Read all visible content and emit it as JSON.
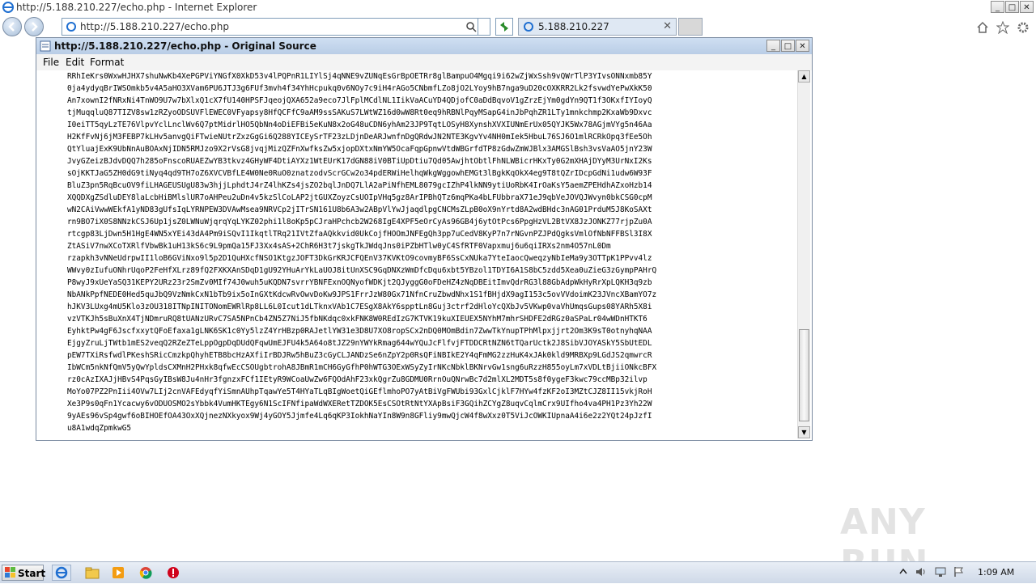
{
  "window": {
    "title": "http://5.188.210.227/echo.php - Internet Explorer",
    "controls": [
      "_",
      "□",
      "✕"
    ]
  },
  "browser": {
    "address_url": "http://5.188.210.227/echo.php",
    "tab_title": "5.188.210.227",
    "tab_close": "✕"
  },
  "source_window": {
    "title": "http://5.188.210.227/echo.php - Original Source",
    "menu": [
      "File",
      "Edit",
      "Format"
    ],
    "lines": [
      "RRhIeKrs0WxwHJHX7shuNwKb4XePGPViYNGfX0XkD53v4lPQPnR1LIYlSj4qNNE9vZUNqEsGrBpOETRr8glBampuO4Mgqi9i62wZjWxSsh9vQWrTlP3YIvsONNxmb85Y",
      "0ja4ydyqBrIWSOmkb5v4A5aHO3XVam6PU6JTJ3g6FUf3mvh4f34YhHcpukq0v6NOy7c9iH4rAGo5CNbmfLZo8jO2LYoy9hB7nga9uD20cOXKRR2Lk2fsvwdYePwXkK50",
      "An7xownI2fNRxNi4TnWO9U7w7bXlxQ1cX7fU140HPSFJqeojQXA652a9eco7JlFplMCdlNL1IikVaACuYD4QDjofC0aDdBqvoV1gZrzEjYm0gdYn9QT1f3OKxfIYIoyQ",
      "tjMuqqluQ87TIZV8sw1zRZyoODSUVFlEWEC0VFyapsy8HfQCFfC9aAM9ssSAKuS7LWtWZ16d0wW8Rt0eq9hRBNlPqyMSapG4inJbPqhZR1LTy1mnkchmp2KxaWb9Dxvc",
      "I0eiTT5qyLzTE76VlpvYclLnclWv6Q7ptMidrlHO5QbNn4oDiEFBi5eKuN8x2oG48uCDN6yhAm23JP9TqtLOSyH8XynshXVXIUNmErUx05QYJK5Wx78AGjmVYg5n46Aa",
      "H2KfFvNj6jM3FEBP7kLHv5anvgQiFTwieNUtrZxzGgGi6Q288YICEySrTF23zLDjnDeARJwnfnDgQRdwJN2NTE3KgvYv4NH0mIek5HbuL76SJ6O1mlRCRkOpq3fEe5Oh",
      "QtYluajExK9UbNnAuBOAxNjIDN5RMJzo9X2rVsG8jvqjMizQZFnXwfksZw5xjopDXtxNmYW5OcaFqpGpnwVtdWBGrfdTP8zGdwZmWJBlx3AMGSlBsh3vsVaAO5jnY23W",
      "JvyGZeizBJdvDQQ7h285oFnscoRUAEZwYB3tkvz4GHyWF4DtiAYXz1WtEUrK17dGN88iV0BTiUpDtiu7Qd05AwjhtObtlFhNLWBicrHKxTy0G2mXHAjDYyM3UrNxI2Ks",
      "sOjKKTJaG5ZH0dG9tiNyq4qd9TH7oZ6XVCVBfLE4W0Ne0RuO0znatzodvScrGCw2o34pdERWiHelhqWkgWggowhEMGt3lBgkKqOkX4eg9T8tQZrIDcpGdNi1udw6W93F",
      "BluZ3pn5RqBcuOV9fiLHAGEUSUgU83w3hjjLphdtJ4rZ4lhKZs4jsZO2bqlJnDQ7LlA2aPiNfhEML8079gcIZhP4lkNN9ytiUoRbK4IrOaKsY5aemZPEHdhAZxoHzb14",
      "XQQDXgZSdluDEY8laLcbHiBMlslUR7oAHPeu2uDn4v5kzSlCoLAP2jtGUXZoyzCsUOIpVHq5gz8ArIPBhQTz6mqPKa4bLFUbbraX71eJ9qbVeJOVQJWvyn0bkCSG0cpM",
      "wN2CAiVwwWEkfA1yND83gUfsIqLYRNPEW3DVAwMsea9NRVCp2jITrSN161U8b6A3w2ABpVlYwJjaqdlpgCNCMsZLpB0oX9nYrtd8A2wdBHdc3nAG01PrduM5J8KoSAXt",
      "rn9BO7iX0S8NNzkCSJ6Up1jsZ0LWNuWjqrqYqLYKZ02phi1l8oKp5pCJraHPchcb2W268IgE4XPF5eOrCyAs96GB4j6ytOtPcs6PpgHzVL2BtVX8JzJONKZ77rjpZu0A",
      "rtcgp83LjDwn5H1HgE4WN5xYEi43dA4Pm9iSQvI1IkqtlTRq21IVtZfaAQkkvid0UkCojfHOOmJNFEgQh3pp7uCedV8KyP7n7rNGvnPZJPdQgksVmlOfNbNFFBSl3I8X",
      "ZtASiV7nwXCoTXRlfVbwBk1uH13kS6c9L9pmQa15FJ3Xx4sAS+2ChR6H3t7jskgTkJWdqJns0iPZbHTlw0yC4SfRTF0Vapxmuj6u6qiIRXs2nm4O57nL0Dm",
      "rzapkh3vNNeUdrpwII1loB6GViNxo9l5p2D1QuHXcfNSO1KtgzJOFT3DkGrKRJCFQEnV37KVKtO9covmyBF6SsCxNUka7YteIaocQweqzyNbIeMa9y3OTTpK1PPvv4lz",
      "WWvy0zIufuONhrUqoP2FeHfXLrz89fQ2FXKXAnSDqD1gU92YHuArYkLaUOJ8itUnXSC9GqDNXzWmDfcDqu6xbt5YBzol1TDYI6A1S8bC5zdd5Xea0uZieG3zGympPAHrQ",
      "P8wyJ9xUeYaSQ31KEPY2URz23r2SmZv0MIf74J0wuh5uKQDN7svrrYBNFExnOQNyofWDKjt2QJyggG0oFDeHZ4zNqDBEitImvQdrRG3l88GbAdpWkHyRrXpLQKH3q9zb",
      "NbANkPpfNEDE0Hed5quJbQ9VzNmkCxN1bTb9ix5oInGXtKdcwRvOwvDoKw9JPS1FrrJzW80Gx71NfnCruZbwdNhx1S1fBHjdX9agI153c5ovVVdoimK23JVncXBamYO7z",
      "hJKV3LUxg4mU5Klo3zOU318ITNpINITONomEWRlRp8LL6L0Icut1dLTknxVAb1C7ESgX8AkY6spptLn8Guj3ctrf2dHloYcQXbJv5VKwp0vaVhUmqsGups08YARh5X8i",
      "vzVTKJh5sBuXnX4TjNDmruRQ8tUANzURvC7SA5NPnCb4ZN5Z7NiJ5fbNKdqc0xkFNK8W0REdIzG7KTVK19kuXIEUEX5NYhM7mhrSHDFE2dRGz0aSPaLr04wWDnHTKT6",
      "EyhktPw4gF6JscfxxytQFoEfaxa1gLNK6SK1c0Yy5lzZ4YrHBzp0RAJetlYW31e3D8U7XO8ropSCx2nDQ0MOmBdin7ZwwTkYnupTPhMlpxjjrt2Om3K9sT0otnyhqNAA",
      "EjgyZruLjTWtb1mES2veqQ2RZeZTeLppOgpDqDUdQFqwUmEJFU4k5A64o8tJZ29nYWYkRmag644wYQuJcFlfvjFTDDCRtNZN6tTQarUctk2J8SibVJOYASkY5SbUtEDL",
      "pEW7TXiRsfwdlPKeshSRicCmzkpQhyhETB8bcHzAXfiIrBDJRw5hBuZ3cGyCLJANDzSe6nZpY2p0RsQFiNBIkE2Y4qFmMG2zzHuK4xJAk0kld9MRBXp9LGdJS2qmwrcR",
      "IbWCm5nkNfQmV5yQwYpldsCXMnH2PHxk8qfwEcCSOUgbtrohA8JBmR1mCH6GyGfhP0hWTG3OExWSyZyIrNKcNbklBKNrvGw1sng6uRzzH855oyLm7xVDLtBjiiONkcBFX",
      "rz0cAzIXAJjHBvS4PqsGyIBsW8Ju4nHr3fgnzxFCf1IEtyR9WCoaUwZw6FQOdAhF23xkQgrZu8GDMU0RrnOuQNrwBc7d2mlXL2MDT5s8f0ygeF3kwc79ccMBp32ilvp",
      "MoYo07PZ2PnIii4OVw7LIj2cnVAFEdyqfYiSmnAUhpTqawYe5T4HYaTLqBIgWoetQiGEflmhoPO7yAtBiVgFWUbi93GxlCjklF7HYw4fzKF2oI3MZtCJZ8II15vkjRoH",
      "Xe3P9s0qFn1Ycacwy6vODUOSMO2sYbbk4VumHKTEgy6N1ScIFNfipaWdWXERetTZDOK5EsCSOtRtNtYXApBsiF3GQihZCYgZ8uqvCqlmCrx9UIfho4va4PH1Pz3Yh22W",
      "9yAEs96vSp4gwf6oBIHOEfOA43OxXQjnezNXkyox9Wj4yGOY5Jjmfe4Lq6qKP3IokhNaYIn8W9n8GFliy9mwQjcW4f8wXxz0T5ViJcOWKIUpnaA4i6e2z2YQt24pJzfI",
      "u8A1wdqZpmkwG5"
    ]
  },
  "taskbar": {
    "start_label": "Start",
    "clock": "1:09 AM"
  },
  "watermark": "ANY RUN"
}
